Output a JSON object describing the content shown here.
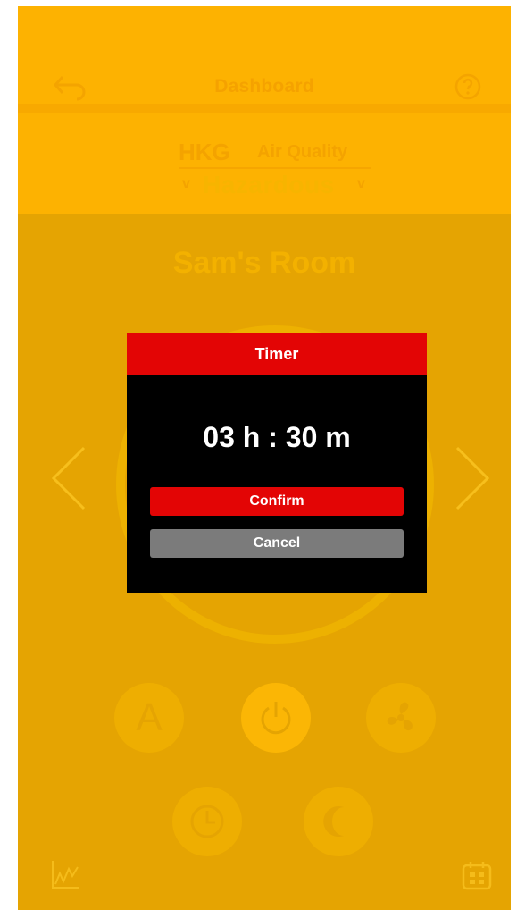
{
  "header": {
    "title": "Dashboard",
    "back_icon": "back-arrow-icon",
    "help_icon": "help-icon"
  },
  "air_quality": {
    "city": "HKG",
    "label": "Air Quality",
    "value": "Hazardous",
    "chevron": "v"
  },
  "room": {
    "name": "Sam's Room"
  },
  "controls": {
    "auto_label": "A",
    "icons": [
      "auto-mode-icon",
      "power-icon",
      "fan-icon",
      "timer-icon",
      "night-mode-icon"
    ]
  },
  "bottom_bar": {
    "left_icon": "chart-icon",
    "right_icon": "schedule-icon"
  },
  "timer_dialog": {
    "title": "Timer",
    "time": "03 h : 30 m",
    "confirm_label": "Confirm",
    "cancel_label": "Cancel"
  },
  "colors": {
    "background": "#e5a402",
    "header": "#fdb201",
    "dialog_accent": "#e30505",
    "dialog_body": "#000000",
    "cancel": "#7b7b7b"
  }
}
